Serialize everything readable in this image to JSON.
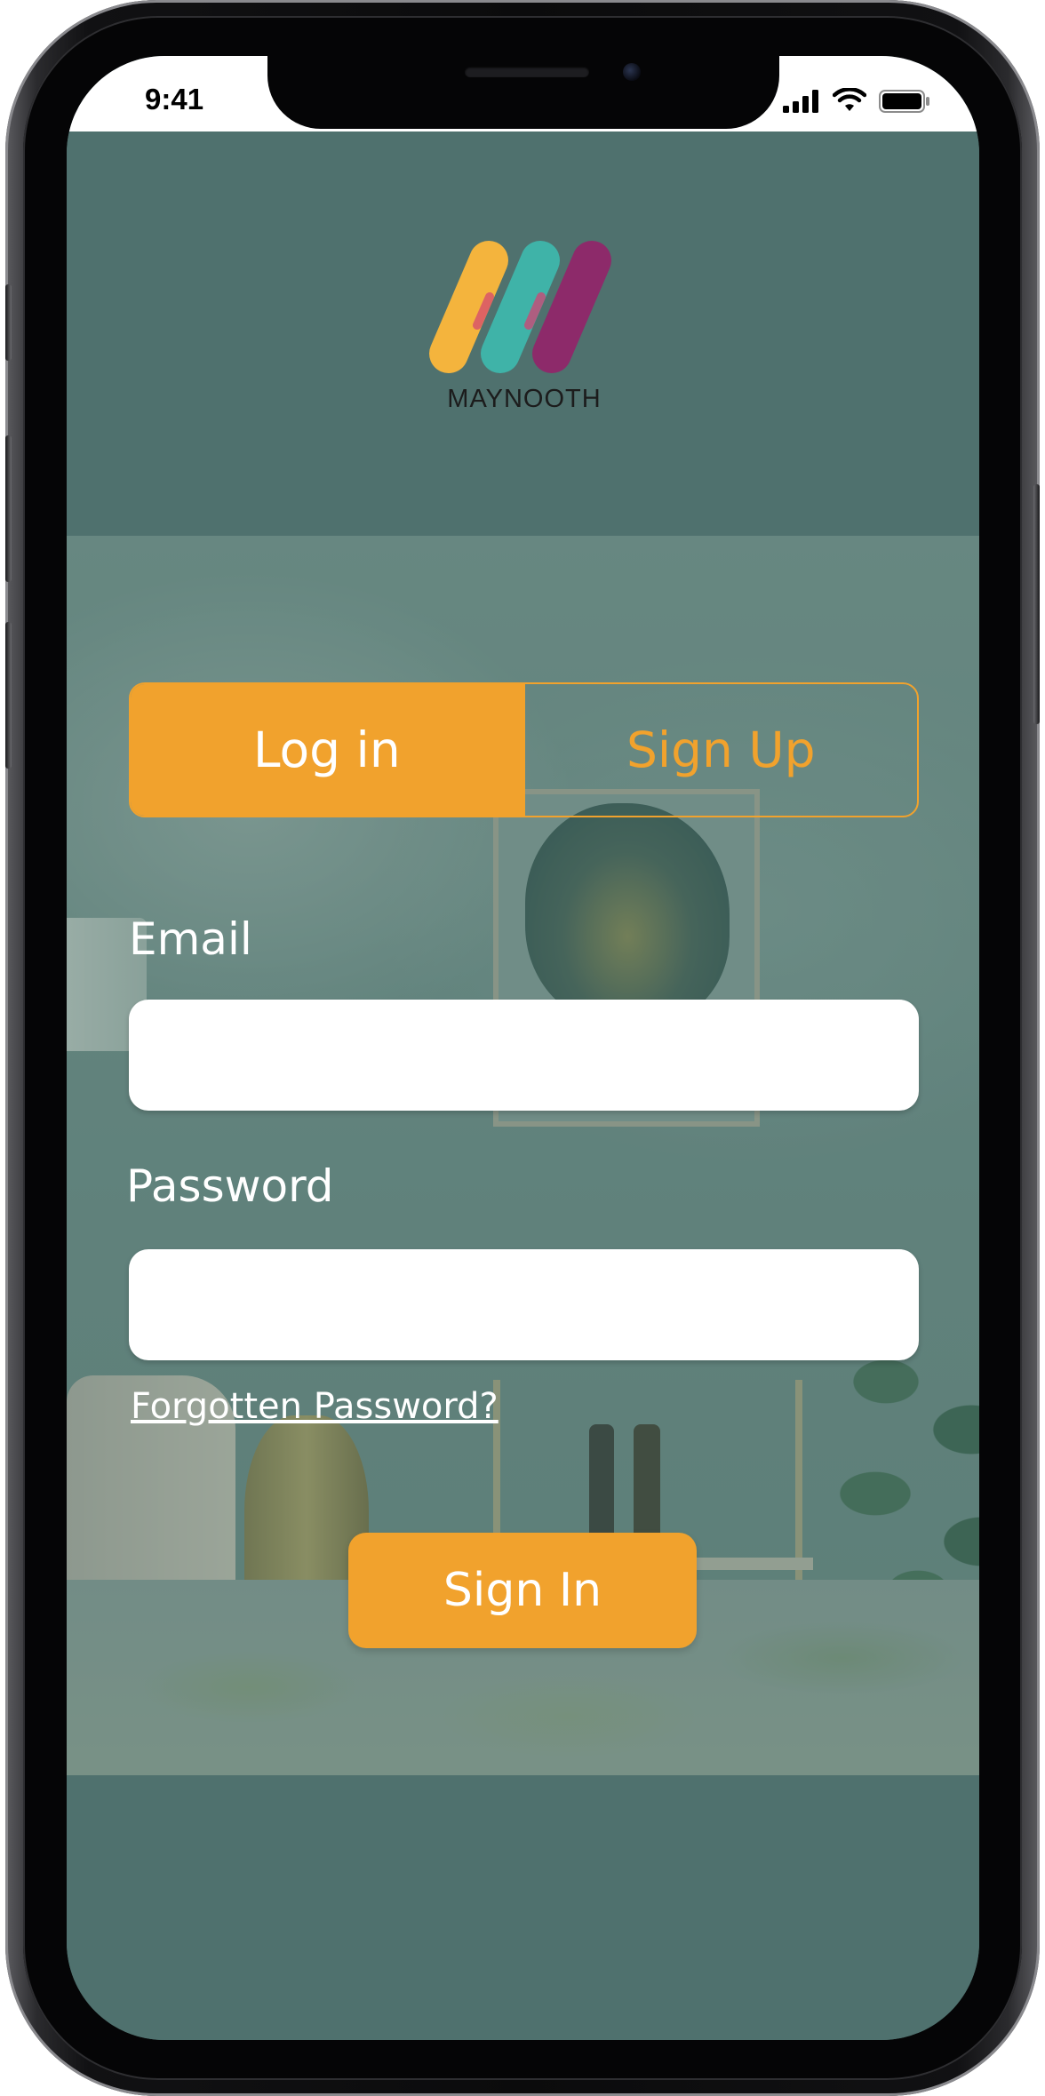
{
  "status_bar": {
    "time": "9:41",
    "icons": [
      "signal-icon",
      "wifi-icon",
      "battery-icon"
    ]
  },
  "brand": {
    "name": "MAYNOOTH",
    "logo_colors": [
      "#f4b43d",
      "#3fb3a8",
      "#8d2a6a"
    ]
  },
  "auth_toggle": {
    "login_label": "Log in",
    "signup_label": "Sign Up",
    "active": "login"
  },
  "form": {
    "email_label": "Email",
    "email_value": "",
    "password_label": "Password",
    "password_value": "",
    "forgot_label": "Forgotten Password?",
    "submit_label": "Sign In"
  },
  "colors": {
    "accent": "#f1a22d",
    "background": "#4f716e",
    "text_on_bg": "#ffffff"
  }
}
